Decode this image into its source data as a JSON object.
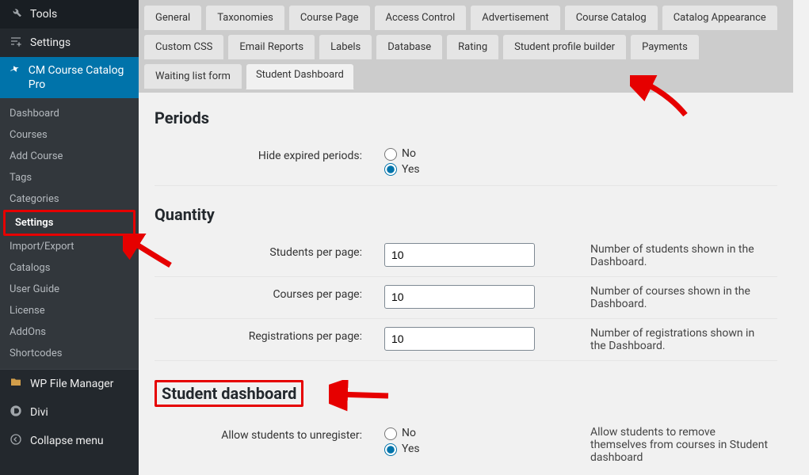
{
  "sidebar": {
    "top": [
      {
        "icon": "wrench",
        "label": "Tools"
      },
      {
        "icon": "sliders",
        "label": "Settings"
      }
    ],
    "plugin": {
      "icon": "pin",
      "label": "CM Course Catalog Pro"
    },
    "submenu": [
      {
        "label": "Dashboard"
      },
      {
        "label": "Courses"
      },
      {
        "label": "Add Course"
      },
      {
        "label": "Tags"
      },
      {
        "label": "Categories"
      },
      {
        "label": "Settings",
        "active": true,
        "hi": true
      },
      {
        "label": "Import/Export"
      },
      {
        "label": "Catalogs"
      },
      {
        "label": "User Guide"
      },
      {
        "label": "License"
      },
      {
        "label": "AddOns"
      },
      {
        "label": "Shortcodes"
      }
    ],
    "bottom": [
      {
        "icon": "folder",
        "label": "WP File Manager"
      },
      {
        "icon": "divi",
        "label": "Divi"
      },
      {
        "icon": "collapse",
        "label": "Collapse menu"
      }
    ]
  },
  "tabs": {
    "row": [
      "General",
      "Taxonomies",
      "Course Page",
      "Access Control",
      "Advertisement",
      "Course Catalog",
      "Catalog Appearance",
      "Custom CSS",
      "Email Reports",
      "Labels",
      "Database",
      "Rating",
      "Student profile builder",
      "Payments",
      "Waiting list form",
      "Student Dashboard"
    ],
    "activeIndex": 15
  },
  "sections": {
    "periods": {
      "title": "Periods",
      "hide_label": "Hide expired periods:",
      "no": "No",
      "yes": "Yes"
    },
    "quantity": {
      "title": "Quantity",
      "rows": [
        {
          "label": "Students per page:",
          "value": "10",
          "desc": "Number of students shown in the Dashboard."
        },
        {
          "label": "Courses per page:",
          "value": "10",
          "desc": "Number of courses shown in the Dashboard."
        },
        {
          "label": "Registrations per page:",
          "value": "10",
          "desc": "Number of registrations shown in the Dashboard."
        }
      ]
    },
    "studentdash": {
      "title": "Student dashboard",
      "unreg_label": "Allow students to unregister:",
      "no": "No",
      "yes": "Yes",
      "desc": "Allow students to remove themselves from courses in Student dashboard"
    }
  }
}
